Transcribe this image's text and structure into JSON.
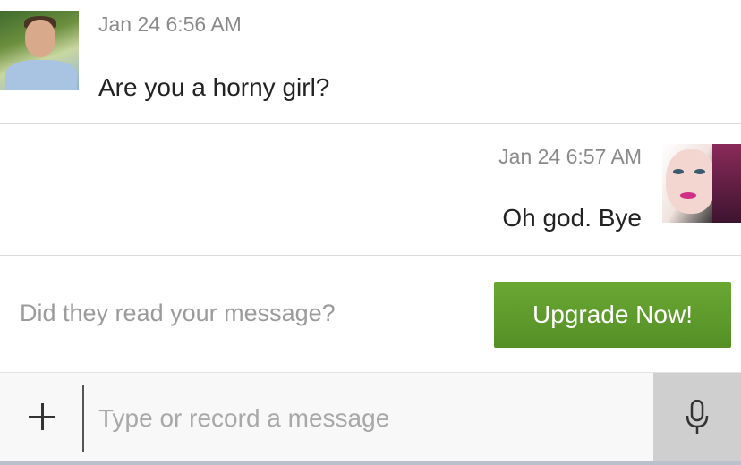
{
  "messages": [
    {
      "timestamp": "Jan 24 6:56 AM",
      "text": "Are you a horny girl?",
      "avatar": "male-user-photo"
    },
    {
      "timestamp": "Jan 24 6:57 AM",
      "text": "Oh god. Bye",
      "avatar": "female-user-photo"
    }
  ],
  "upsell": {
    "prompt": "Did they read your message?",
    "button_label": "Upgrade Now!"
  },
  "composer": {
    "add_icon": "plus-icon",
    "placeholder": "Type or record a message",
    "mic_icon": "microphone-icon"
  },
  "colors": {
    "upgrade_button": "#5a9a2b",
    "mic_background": "#cfcfcf"
  }
}
